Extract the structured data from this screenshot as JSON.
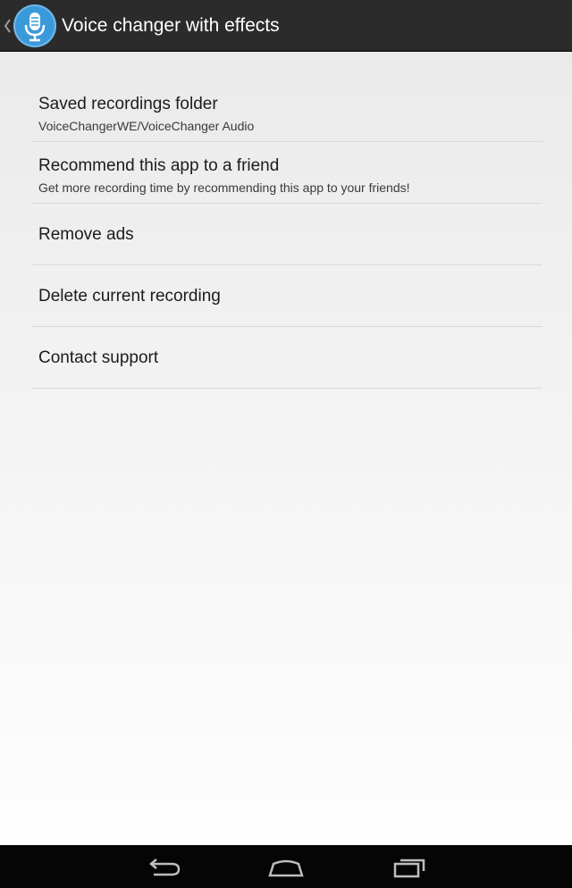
{
  "actionbar": {
    "title": "Voice changer with effects",
    "icons": {
      "up": "chevron-left-icon",
      "app": "microphone-icon"
    },
    "background": "#2b2b2b",
    "app_icon_color": "#3a9ad9"
  },
  "settings": {
    "items": [
      {
        "primary": "Saved recordings folder",
        "secondary": "VoiceChangerWE/VoiceChanger Audio"
      },
      {
        "primary": "Recommend this app to a friend",
        "secondary": "Get more recording time by recommending this app to your friends!"
      },
      {
        "primary": "Remove ads"
      },
      {
        "primary": "Delete current recording"
      },
      {
        "primary": "Contact support"
      }
    ]
  },
  "navbar": {
    "icons": [
      "back-icon",
      "home-icon",
      "recent-apps-icon"
    ]
  }
}
